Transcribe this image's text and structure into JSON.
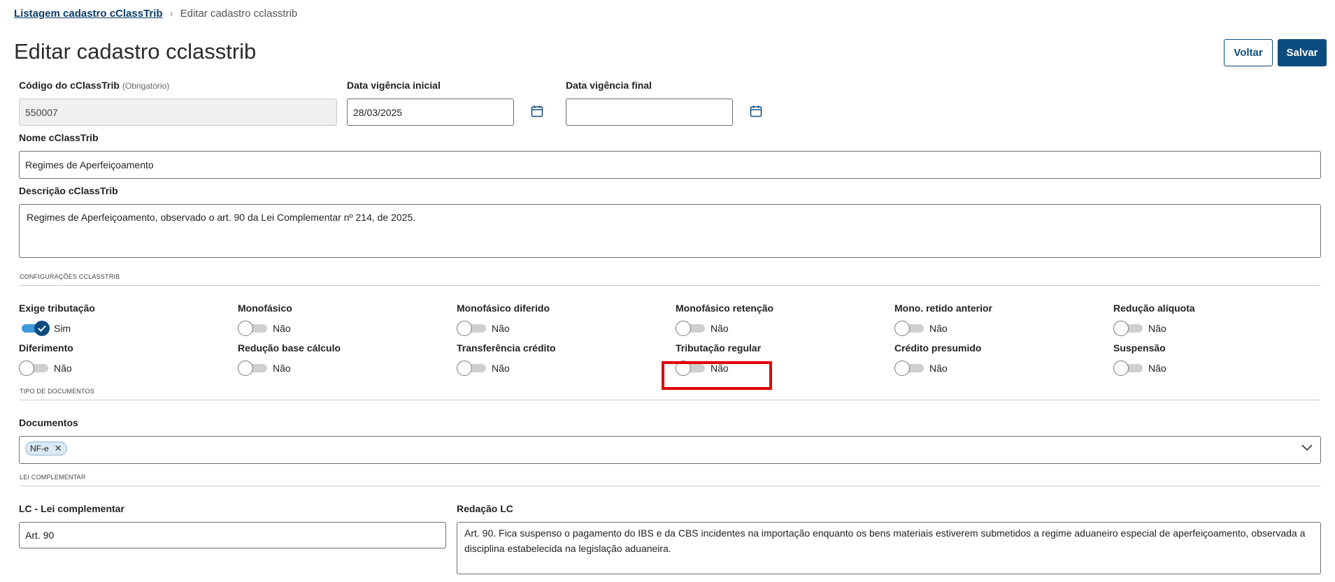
{
  "breadcrumb": {
    "link": "Listagem cadastro cClassTrib",
    "separator": "›",
    "current": "Editar cadastro cclasstrib"
  },
  "page": {
    "title": "Editar cadastro cclasstrib"
  },
  "actions": {
    "back": "Voltar",
    "save": "Salvar"
  },
  "fields": {
    "codigo": {
      "label": "Código do cClassTrib",
      "hint": "(Obrigatório)",
      "value": "550007"
    },
    "vigencia_inicial": {
      "label": "Data vigência inicial",
      "value": "28/03/2025"
    },
    "vigencia_final": {
      "label": "Data vigência final",
      "value": ""
    },
    "nome": {
      "label": "Nome cClassTrib",
      "value": "Regimes de Aperfeiçoamento"
    },
    "descricao": {
      "label": "Descrição cClassTrib",
      "value": "Regimes de Aperfeiçoamento, observado o art. 90 da Lei Complementar nº 214, de 2025."
    }
  },
  "config_section": {
    "title": "CONFIGURAÇÕES CCLASSTRIB",
    "toggles": [
      {
        "label": "Exige tributação",
        "on": true,
        "value": "Sim"
      },
      {
        "label": "Monofásico",
        "on": false,
        "value": "Não"
      },
      {
        "label": "Monofásico diferido",
        "on": false,
        "value": "Não"
      },
      {
        "label": "Monofásico retenção",
        "on": false,
        "value": "Não"
      },
      {
        "label": "Mono. retido anterior",
        "on": false,
        "value": "Não"
      },
      {
        "label": "Redução alíquota",
        "on": false,
        "value": "Não"
      },
      {
        "label": "Diferimento",
        "on": false,
        "value": "Não"
      },
      {
        "label": "Redução base cálculo",
        "on": false,
        "value": "Não"
      },
      {
        "label": "Transferência crédito",
        "on": false,
        "value": "Não"
      },
      {
        "label": "Tributação regular",
        "on": false,
        "value": "Não"
      },
      {
        "label": "Crédito presumido",
        "on": false,
        "value": "Não"
      },
      {
        "label": "Suspensão",
        "on": false,
        "value": "Não"
      }
    ]
  },
  "documents_section": {
    "title": "TIPO DE DOCUMENTOS",
    "label": "Documentos",
    "chips": [
      "NF-e"
    ]
  },
  "lc_section": {
    "title": "LEI COMPLEMENTAR",
    "lc_label": "LC - Lei complementar",
    "lc_value": "Art. 90",
    "redacao_label": "Redação LC",
    "redacao_value": "Art. 90. Fica suspenso o pagamento do IBS e da CBS incidentes na importação enquanto os bens materiais estiverem submetidos a regime aduaneiro especial de aperfeiçoamento, observada a disciplina estabelecida na legislação aduaneira."
  },
  "colors": {
    "primary": "#0c4b7e",
    "toggle_on": "#3f98d8",
    "highlight": "#e00000"
  }
}
